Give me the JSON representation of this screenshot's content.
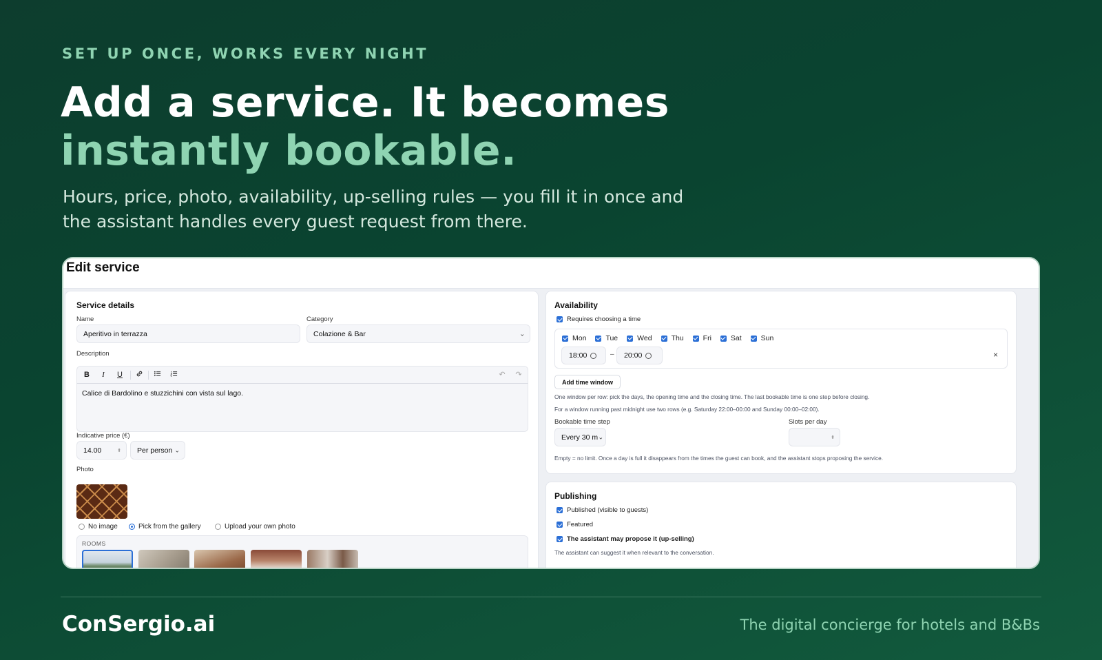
{
  "hero": {
    "eyebrow": "SET UP ONCE, WORKS EVERY NIGHT",
    "headline_line1": "Add a service. It becomes",
    "headline_line2": "instantly bookable.",
    "subtitle_line1": "Hours, price, photo, availability, up-selling rules — you fill it in once and",
    "subtitle_line2": "the assistant handles every guest request from there."
  },
  "screen": {
    "title": "Edit service",
    "service_details": {
      "title": "Service details",
      "name_label": "Name",
      "name_value": "Aperitivo in terrazza",
      "category_label": "Category",
      "category_value": "Colazione & Bar",
      "description_label": "Description",
      "description_value": "Calice di Bardolino e stuzzichini con vista sul lago.",
      "toolbar": {
        "bold": "B",
        "italic": "I",
        "underline": "U",
        "undo": "↶",
        "redo": "↷"
      },
      "price_label": "Indicative price (€)",
      "price_value": "14.00",
      "price_unit": "Per person",
      "photo_label": "Photo",
      "photo_options": [
        "No image",
        "Pick from the gallery",
        "Upload your own photo"
      ],
      "photo_selected": "Pick from the gallery",
      "gallery_label": "ROOMS"
    },
    "availability": {
      "title": "Availability",
      "requires_time": "Requires choosing a time",
      "days": [
        "Mon",
        "Tue",
        "Wed",
        "Thu",
        "Fri",
        "Sat",
        "Sun"
      ],
      "open_h": "18",
      "open_m": "00",
      "close_h": "20",
      "close_m": "00",
      "dash": "–",
      "remove": "×",
      "add_window": "Add time window",
      "hint1": "One window per row: pick the days, the opening time and the closing time. The last bookable time is one step before closing.",
      "hint2": "For a window running past midnight use two rows (e.g. Saturday 22:00–00:00 and Sunday 00:00–02:00).",
      "step_label": "Bookable time step",
      "step_value": "Every 30 m",
      "slots_label": "Slots per day",
      "slots_hint": "Empty = no limit. Once a day is full it disappears from the times the guest can book, and the assistant stops proposing the service."
    },
    "publishing": {
      "title": "Publishing",
      "published": "Published (visible to guests)",
      "featured": "Featured",
      "upsell": "The assistant may propose it (up-selling)",
      "upsell_hint": "The assistant can suggest it when relevant to the conversation."
    }
  },
  "footer": {
    "brand": "ConSergio.ai",
    "tagline": "The digital concierge for hotels and B&Bs"
  },
  "colors": {
    "background": "#0b4532",
    "accent_mint": "#8fd4b2",
    "checkbox_blue": "#2b6fd6"
  }
}
